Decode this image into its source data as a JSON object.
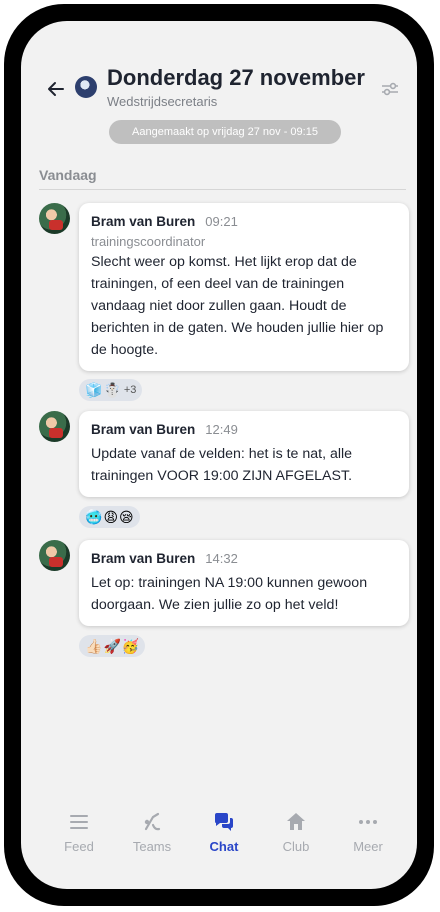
{
  "header": {
    "title": "Donderdag 27 november",
    "subtitle": "Wedstrijdsecretaris",
    "created": "Aangemaakt op vrijdag 27 nov - 09:15"
  },
  "section_label": "Vandaag",
  "messages": [
    {
      "author": "Bram van Buren",
      "time": "09:21",
      "role": "trainingscoordinator",
      "text": "Slecht weer op komst. Het lijkt erop dat de trainingen, of een deel van de trainingen vandaag niet door zullen gaan. Houdt de berichten in de gaten. We houden jullie hier op de hoogte.",
      "reactions": [
        "🧊",
        "☃️"
      ],
      "reactions_more": "+3"
    },
    {
      "author": "Bram van Buren",
      "time": "12:49",
      "text": "Update vanaf de velden: het is te nat, alle trainingen VOOR 19:00 ZIJN AFGELAST.",
      "reactions": [
        "🥶",
        "😩",
        "😪"
      ]
    },
    {
      "author": "Bram van Buren",
      "time": "14:32",
      "text": "Let op: trainingen NA 19:00 kunnen gewoon doorgaan. We zien jullie zo op het veld!",
      "reactions": [
        "👍🏻",
        "🚀",
        "🥳"
      ]
    }
  ],
  "tabs": [
    {
      "label": "Feed",
      "icon": "menu-icon"
    },
    {
      "label": "Teams",
      "icon": "teams-icon"
    },
    {
      "label": "Chat",
      "icon": "chat-icon",
      "active": true
    },
    {
      "label": "Club",
      "icon": "home-icon"
    },
    {
      "label": "Meer",
      "icon": "more-icon"
    }
  ],
  "colors": {
    "accent": "#2a46c8",
    "background": "#f2f2f2",
    "pill": "#bfbfbf",
    "reaction_bg": "#dfe3ea"
  }
}
